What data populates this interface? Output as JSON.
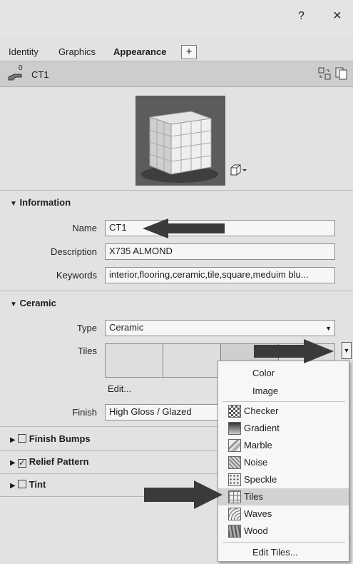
{
  "window": {
    "help_label": "?",
    "close_label": "×"
  },
  "tabs": [
    {
      "label": "Identity"
    },
    {
      "label": "Graphics"
    },
    {
      "label": "Appearance",
      "active": true
    }
  ],
  "tab_add_label": "+",
  "material": {
    "user_count": "0",
    "name": "CT1"
  },
  "information": {
    "heading": "Information",
    "name_label": "Name",
    "name_value": "CT1",
    "description_label": "Description",
    "description_value": "X735 ALMOND",
    "keywords_label": "Keywords",
    "keywords_value": "interior,flooring,ceramic,tile,square,meduim blu..."
  },
  "ceramic": {
    "heading": "Ceramic",
    "type_label": "Type",
    "type_value": "Ceramic",
    "tiles_label": "Tiles",
    "edit_label": "Edit...",
    "finish_label": "Finish",
    "finish_value": "High Gloss / Glazed"
  },
  "options": [
    {
      "label": "Finish Bumps",
      "checked": false
    },
    {
      "label": "Relief Pattern",
      "checked": true
    },
    {
      "label": "Tint",
      "checked": false
    }
  ],
  "dropdown_menu": {
    "items": [
      {
        "label": "Color",
        "icon": null
      },
      {
        "label": "Image",
        "icon": null
      },
      {
        "label": "Checker",
        "icon": "checker-icon"
      },
      {
        "label": "Gradient",
        "icon": "gradient-icon"
      },
      {
        "label": "Marble",
        "icon": "marble-icon"
      },
      {
        "label": "Noise",
        "icon": "noise-icon"
      },
      {
        "label": "Speckle",
        "icon": "speckle-icon"
      },
      {
        "label": "Tiles",
        "icon": "tiles-icon",
        "highlighted": true
      },
      {
        "label": "Waves",
        "icon": "waves-icon"
      },
      {
        "label": "Wood",
        "icon": "wood-icon"
      }
    ],
    "edit_tiles_label": "Edit Tiles..."
  },
  "colors": {
    "arrow": "#3a3a3a",
    "highlight": "#d2d2d2"
  }
}
